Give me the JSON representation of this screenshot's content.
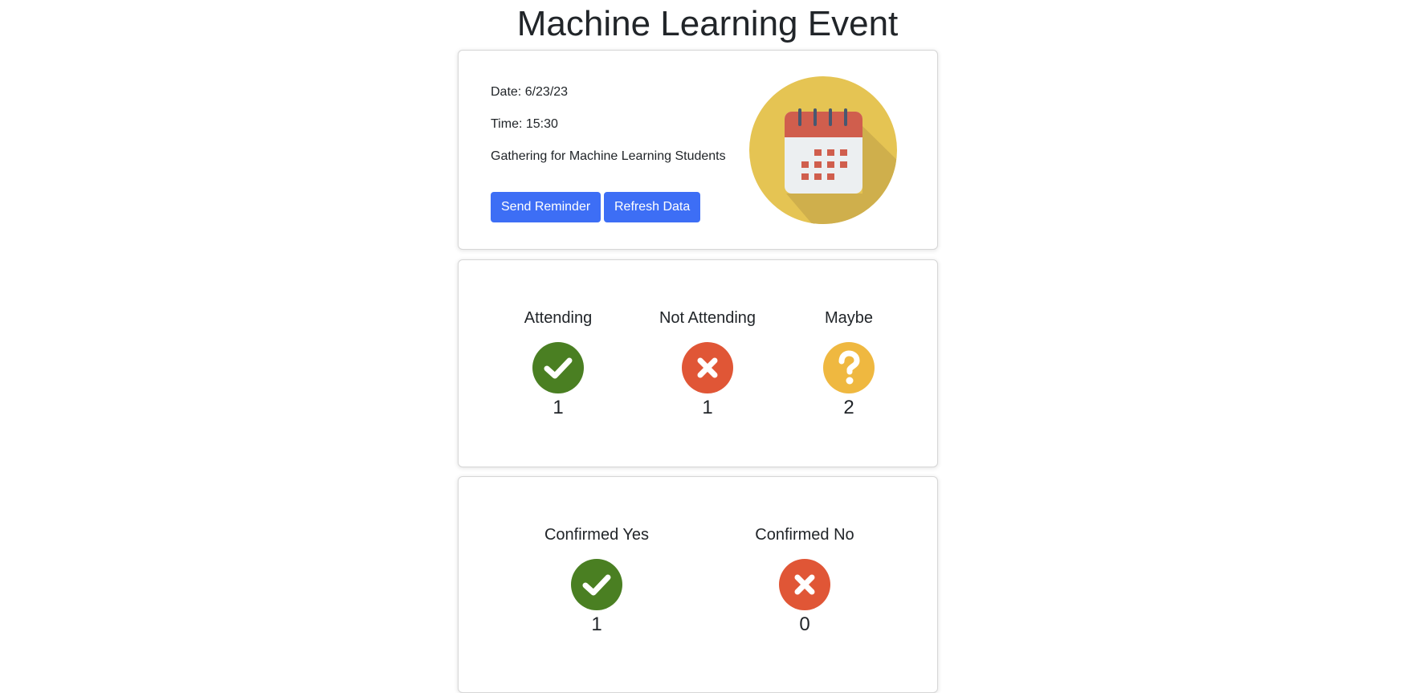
{
  "page": {
    "title": "Machine Learning Event"
  },
  "event": {
    "date": "Date: 6/23/23",
    "time": "Time: 15:30",
    "description": "Gathering for Machine Learning Students",
    "buttons": {
      "send_reminder": "Send Reminder",
      "refresh_data": "Refresh Data"
    },
    "illustration": "calendar-icon"
  },
  "rsvp": {
    "attending": {
      "label": "Attending",
      "count": "1",
      "icon": "check-icon",
      "color": "#4a7f22"
    },
    "not_attending": {
      "label": "Not Attending",
      "count": "1",
      "icon": "x-icon",
      "color": "#e05636"
    },
    "maybe": {
      "label": "Maybe",
      "count": "2",
      "icon": "question-icon",
      "color": "#efb840"
    }
  },
  "confirmed": {
    "yes": {
      "label": "Confirmed Yes",
      "count": "1",
      "icon": "check-icon",
      "color": "#4a7f22"
    },
    "no": {
      "label": "Confirmed No",
      "count": "0",
      "icon": "x-icon",
      "color": "#e05636"
    }
  },
  "colors": {
    "button": "#3d6ef5",
    "calendar_bg": "#e5c453"
  }
}
